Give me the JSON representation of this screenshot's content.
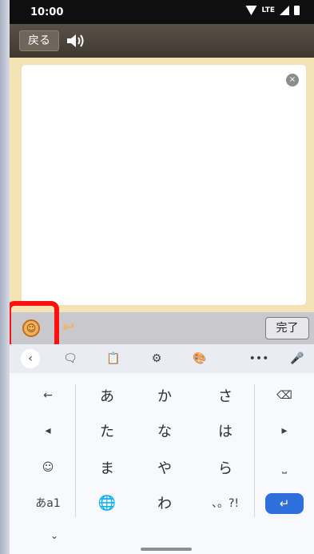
{
  "status_bar": {
    "time": "10:00",
    "network": "LTE"
  },
  "header": {
    "back_label": "戻る"
  },
  "editor": {
    "clear_symbol": "×"
  },
  "toolbar": {
    "done_label": "完了",
    "hook_symbol": "↩"
  },
  "keyboard": {
    "top_row": {
      "back": "‹",
      "sticker": "🗨",
      "clipboard": "📋",
      "settings": "⚙",
      "theme": "🎨",
      "more": "•••",
      "mic": "🎤"
    },
    "rows": [
      [
        "←",
        "あ",
        "か",
        "さ",
        "⌫"
      ],
      [
        "◂",
        "た",
        "な",
        "は",
        "▸"
      ],
      [
        "☺",
        "ま",
        "や",
        "ら",
        "⎵"
      ],
      [
        "あa1",
        "🌐",
        "わ",
        "、。?!",
        "↵"
      ]
    ],
    "bottom": {
      "hide": "⌄"
    }
  }
}
